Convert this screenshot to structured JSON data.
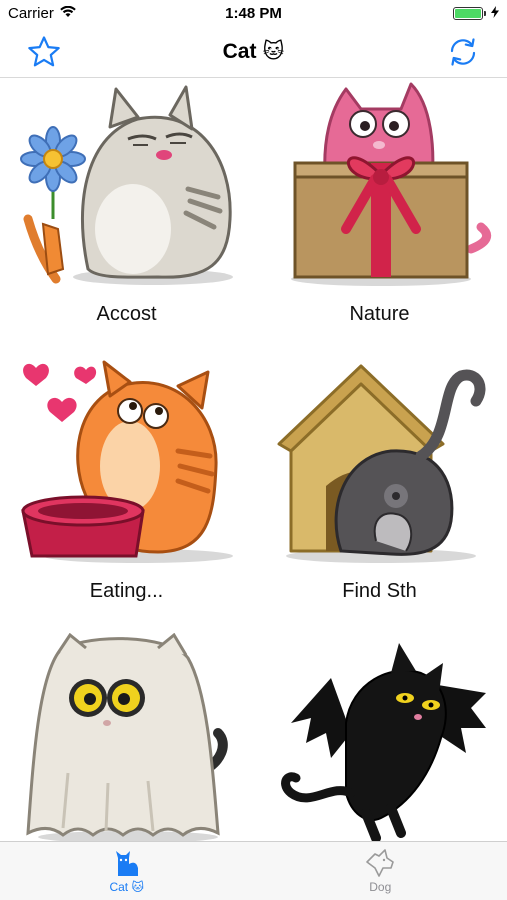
{
  "status_bar": {
    "carrier": "Carrier",
    "time": "1:48 PM",
    "battery_level": 1.0,
    "icons": [
      "wifi-icon",
      "battery-icon",
      "charging-bolt-icon"
    ]
  },
  "nav": {
    "title": "Cat",
    "title_emoji": "🐱",
    "left_icon": "star-icon",
    "right_icon": "refresh-icon",
    "accent": "#1a7cf4"
  },
  "stickers": [
    {
      "label": "Accost",
      "icon": "cat-with-flower"
    },
    {
      "label": "Nature",
      "icon": "cat-in-gift-box"
    },
    {
      "label": "Eating...",
      "icon": "cat-with-hearts-and-bowl"
    },
    {
      "label": "Find Sth",
      "icon": "cat-in-doghouse"
    },
    {
      "label": "",
      "icon": "ghost-cat"
    },
    {
      "label": "",
      "icon": "bat-cat"
    }
  ],
  "tabs": [
    {
      "label": "Cat",
      "emoji": "🐱",
      "icon": "cat-tab-icon",
      "active": true
    },
    {
      "label": "Dog",
      "icon": "dog-tab-icon",
      "active": false
    }
  ]
}
